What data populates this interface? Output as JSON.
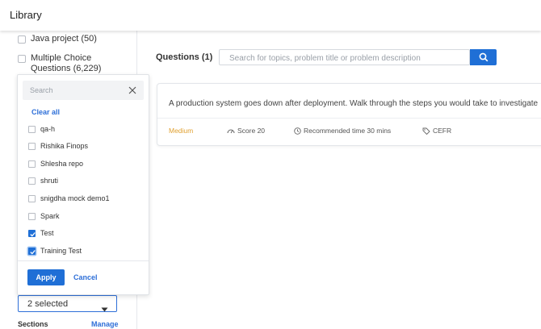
{
  "header": {
    "title": "Library"
  },
  "sidebar": {
    "items": [
      {
        "label": "Java project (50)"
      },
      {
        "label_line1": "Multiple Choice",
        "label_line2": "Questions (6,229)"
      }
    ]
  },
  "filter_dropdown": {
    "search_placeholder": "Search",
    "clear_all": "Clear all",
    "options": [
      {
        "label": "qa-h",
        "checked": false
      },
      {
        "label": "Rishika Finops",
        "checked": false
      },
      {
        "label": "Shlesha repo",
        "checked": false
      },
      {
        "label": "shruti",
        "checked": false
      },
      {
        "label": "snigdha mock demo1",
        "checked": false
      },
      {
        "label": "Spark",
        "checked": false
      },
      {
        "label": "Test",
        "checked": true
      },
      {
        "label": "Training Test",
        "checked": true
      }
    ],
    "apply_label": "Apply",
    "cancel_label": "Cancel",
    "selected_value": "2 selected"
  },
  "sections": {
    "label": "Sections",
    "manage_label": "Manage"
  },
  "main": {
    "title": "Questions (1)",
    "search_placeholder": "Search for topics, problem title or problem description",
    "question": {
      "description": "A production system goes down after deployment. Walk through the steps you would take to investigate",
      "difficulty": "Medium",
      "score": "Score 20",
      "recommended_time": "Recommended time 30 mins",
      "tag": "CEFR"
    }
  },
  "colors": {
    "accent": "#1f6fd6",
    "difficulty_medium": "#e0a030"
  }
}
